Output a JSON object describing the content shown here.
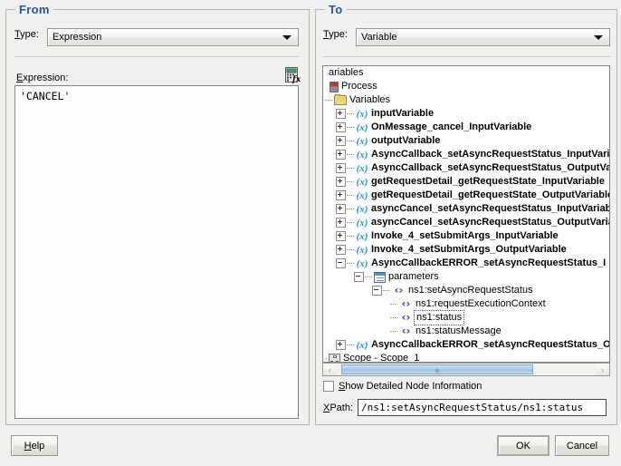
{
  "from_panel": {
    "title": "From",
    "type_label": "Type:",
    "type_mnemonic": "T",
    "type_value": "Expression",
    "expression_label": "Expression:",
    "expression_mnemonic": "E",
    "expression_value": "'CANCEL'",
    "fx_icon": "calculator-fx-icon"
  },
  "to_panel": {
    "title": "To",
    "type_label": "Type:",
    "type_mnemonic": "T",
    "type_value": "Variable",
    "checkbox_label": "Show Detailed Node Information",
    "checkbox_mnemonic": "S",
    "checkbox_checked": false,
    "xpath_label": "XPath:",
    "xpath_mnemonic": "X",
    "xpath_value": "/ns1:setAsyncRequestStatus/ns1:status",
    "scrollbar": {
      "left_arrow": "‹",
      "right_arrow": "›"
    },
    "tree": [
      {
        "label": "ariables",
        "indent": 0,
        "toggle": "none",
        "icon": "none",
        "selected": false,
        "bold": false,
        "dots": false
      },
      {
        "label": "Process",
        "indent": 4,
        "toggle": "none",
        "icon": "process",
        "selected": false,
        "bold": false,
        "dots": false
      },
      {
        "label": "Variables",
        "indent": 10,
        "toggle": "none",
        "icon": "folder",
        "selected": false,
        "bold": false,
        "dots": true
      },
      {
        "label": "inputVariable",
        "indent": 22,
        "toggle": "plus",
        "icon": "variable",
        "selected": false,
        "bold": true,
        "dots": true
      },
      {
        "label": "OnMessage_cancel_InputVariable",
        "indent": 22,
        "toggle": "plus",
        "icon": "variable",
        "selected": false,
        "bold": true,
        "dots": true
      },
      {
        "label": "outputVariable",
        "indent": 22,
        "toggle": "plus",
        "icon": "variable",
        "selected": false,
        "bold": true,
        "dots": true
      },
      {
        "label": "AsyncCallback_setAsyncRequestStatus_InputVariable",
        "indent": 22,
        "toggle": "plus",
        "icon": "variable",
        "selected": false,
        "bold": true,
        "dots": true
      },
      {
        "label": "AsyncCallback_setAsyncRequestStatus_OutputVariable",
        "indent": 22,
        "toggle": "plus",
        "icon": "variable",
        "selected": false,
        "bold": true,
        "dots": true
      },
      {
        "label": "getRequestDetail_getRequestState_InputVariable",
        "indent": 22,
        "toggle": "plus",
        "icon": "variable",
        "selected": false,
        "bold": true,
        "dots": true
      },
      {
        "label": "getRequestDetail_getRequestState_OutputVariable",
        "indent": 22,
        "toggle": "plus",
        "icon": "variable",
        "selected": false,
        "bold": true,
        "dots": true
      },
      {
        "label": "asyncCancel_setAsyncRequestStatus_InputVariable",
        "indent": 22,
        "toggle": "plus",
        "icon": "variable",
        "selected": false,
        "bold": true,
        "dots": true
      },
      {
        "label": "asyncCancel_setAsyncRequestStatus_OutputVariable",
        "indent": 22,
        "toggle": "plus",
        "icon": "variable",
        "selected": false,
        "bold": true,
        "dots": true
      },
      {
        "label": "Invoke_4_setSubmitArgs_InputVariable",
        "indent": 22,
        "toggle": "plus",
        "icon": "variable",
        "selected": false,
        "bold": true,
        "dots": true
      },
      {
        "label": "Invoke_4_setSubmitArgs_OutputVariable",
        "indent": 22,
        "toggle": "plus",
        "icon": "variable",
        "selected": false,
        "bold": true,
        "dots": true
      },
      {
        "label": "AsyncCallbackERROR_setAsyncRequestStatus_I",
        "indent": 22,
        "toggle": "minus",
        "icon": "variable",
        "selected": false,
        "bold": true,
        "dots": true
      },
      {
        "label": "parameters",
        "indent": 42,
        "toggle": "minus",
        "icon": "parameters",
        "selected": false,
        "bold": false,
        "dots": true
      },
      {
        "label": "ns1:setAsyncRequestStatus",
        "indent": 62,
        "toggle": "minus",
        "icon": "element",
        "selected": false,
        "bold": false,
        "dots": true
      },
      {
        "label": "ns1:requestExecutionContext",
        "indent": 82,
        "toggle": "none",
        "icon": "element",
        "selected": false,
        "bold": false,
        "dots": true
      },
      {
        "label": "ns1:status",
        "indent": 82,
        "toggle": "none",
        "icon": "element",
        "selected": true,
        "bold": false,
        "dots": true
      },
      {
        "label": "ns1:statusMessage",
        "indent": 82,
        "toggle": "none",
        "icon": "element",
        "selected": false,
        "bold": false,
        "dots": true
      },
      {
        "label": "AsyncCallbackERROR_setAsyncRequestStatus_O",
        "indent": 22,
        "toggle": "plus",
        "icon": "variable",
        "selected": false,
        "bold": true,
        "dots": true
      },
      {
        "label": "Scope - Scope_1",
        "indent": 4,
        "toggle": "none",
        "icon": "scope",
        "selected": false,
        "bold": false,
        "dots": true
      }
    ]
  },
  "buttons": {
    "help": "Help",
    "help_mnemonic": "H",
    "ok": "OK",
    "cancel": "Cancel"
  },
  "colors": {
    "group_title": "#2a5699",
    "variable_icon": "#1a9ec4",
    "element_icon": "#4a3f9e",
    "folder_icon": "#e8d27a",
    "scroll_thumb": "#9cc2e6",
    "dialog_bg": "#f0f0ee"
  }
}
